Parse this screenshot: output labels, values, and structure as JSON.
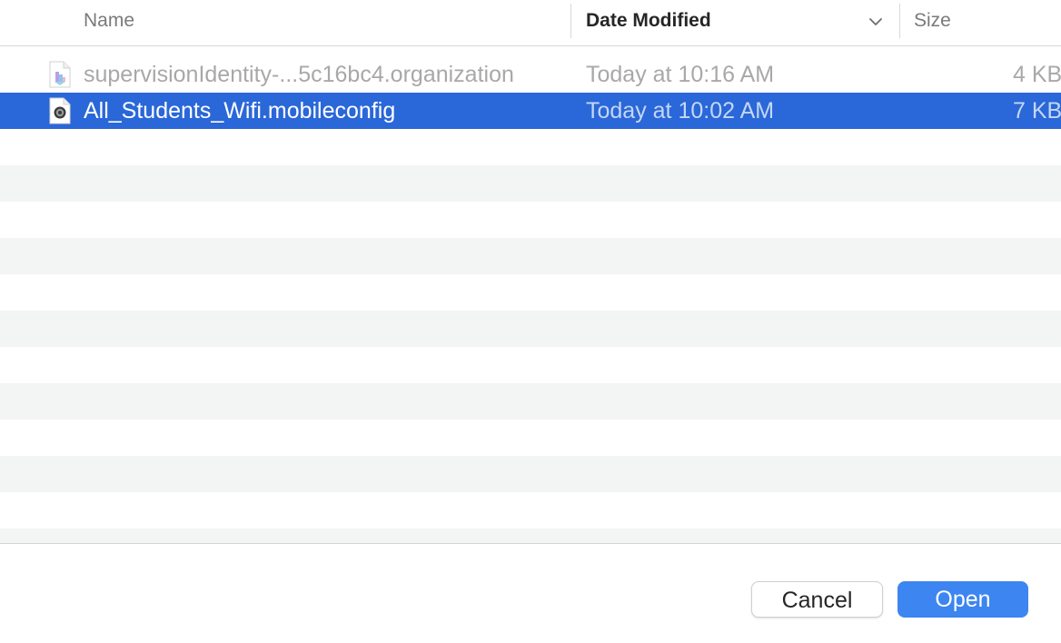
{
  "columns": {
    "name_label": "Name",
    "date_label": "Date Modified",
    "size_label": "Size",
    "sort_column": "Date Modified",
    "sort_icon": "chevron-down-icon"
  },
  "files": [
    {
      "name": "supervisionIdentity-...5c16bc4.organization",
      "date": "Today at 10:16 AM",
      "size": "4 KB",
      "icon": "organization-file-icon",
      "state": "dimmed"
    },
    {
      "name": "All_Students_Wifi.mobileconfig",
      "date": "Today at 10:02 AM",
      "size": "7 KB",
      "icon": "gear-file-icon",
      "state": "selected"
    }
  ],
  "footer": {
    "cancel_label": "Cancel",
    "open_label": "Open"
  },
  "colors": {
    "selection": "#2a67d8",
    "primary_button": "#3d85f0",
    "alt_row": "#f3f4f4"
  }
}
